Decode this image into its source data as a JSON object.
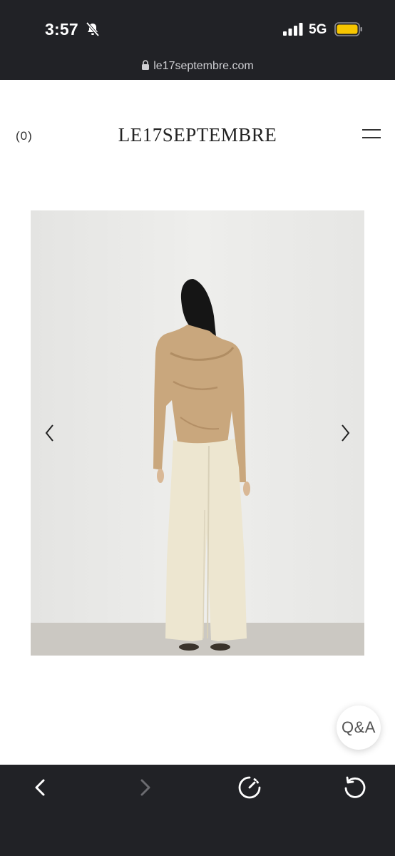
{
  "status_bar": {
    "time": "3:57",
    "network": "5G",
    "battery_color": "#f7c600"
  },
  "browser": {
    "url": "le17septembre.com"
  },
  "header": {
    "cart_label": "(0)",
    "logo": "LE17SEPTEMBRE"
  },
  "gallery": {
    "image_description_icon": "product-photo"
  },
  "qa": {
    "label": "Q&A"
  },
  "colors": {
    "chrome_bg": "#212226",
    "page_bg": "#ffffff",
    "text_dark": "#222222"
  }
}
